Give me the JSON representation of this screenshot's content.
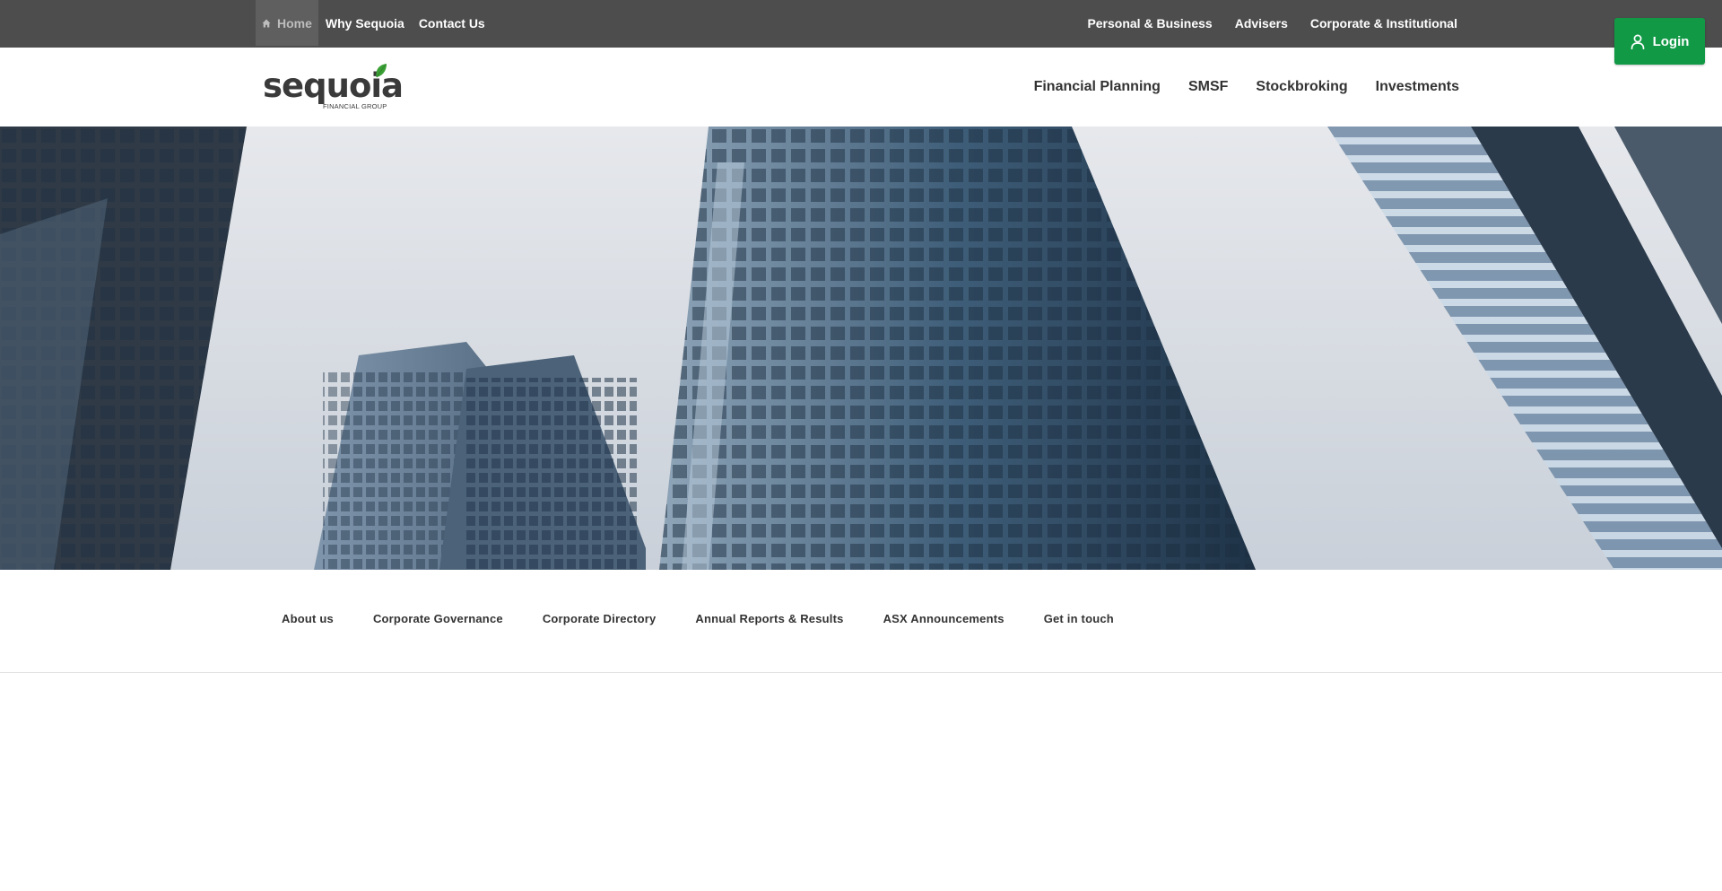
{
  "topbar": {
    "left_links": [
      {
        "label": "Home",
        "icon": "home-icon"
      },
      {
        "label": "Why Sequoia"
      },
      {
        "label": "Contact Us"
      }
    ],
    "right_links": [
      {
        "label": "Personal & Business"
      },
      {
        "label": "Advisers"
      },
      {
        "label": "Corporate & Institutional"
      }
    ]
  },
  "login": {
    "label": "Login",
    "icon": "user-icon",
    "color": "#119946"
  },
  "logo": {
    "wordmark": "sequoia",
    "subtitle": "FINANCIAL GROUP",
    "leaf_color": "#3aa035"
  },
  "main_nav": [
    {
      "label": "Financial Planning"
    },
    {
      "label": "SMSF"
    },
    {
      "label": "Stockbroking"
    },
    {
      "label": "Investments"
    }
  ],
  "hero": {
    "image": "glass-skyscrapers-photo"
  },
  "sub_nav": [
    {
      "label": "About us"
    },
    {
      "label": "Corporate Governance"
    },
    {
      "label": "Corporate Directory"
    },
    {
      "label": "Annual Reports & Results"
    },
    {
      "label": "ASX Announcements"
    },
    {
      "label": "Get in touch"
    }
  ],
  "colors": {
    "topbar": "#4d4d4d",
    "accent": "#119946"
  }
}
